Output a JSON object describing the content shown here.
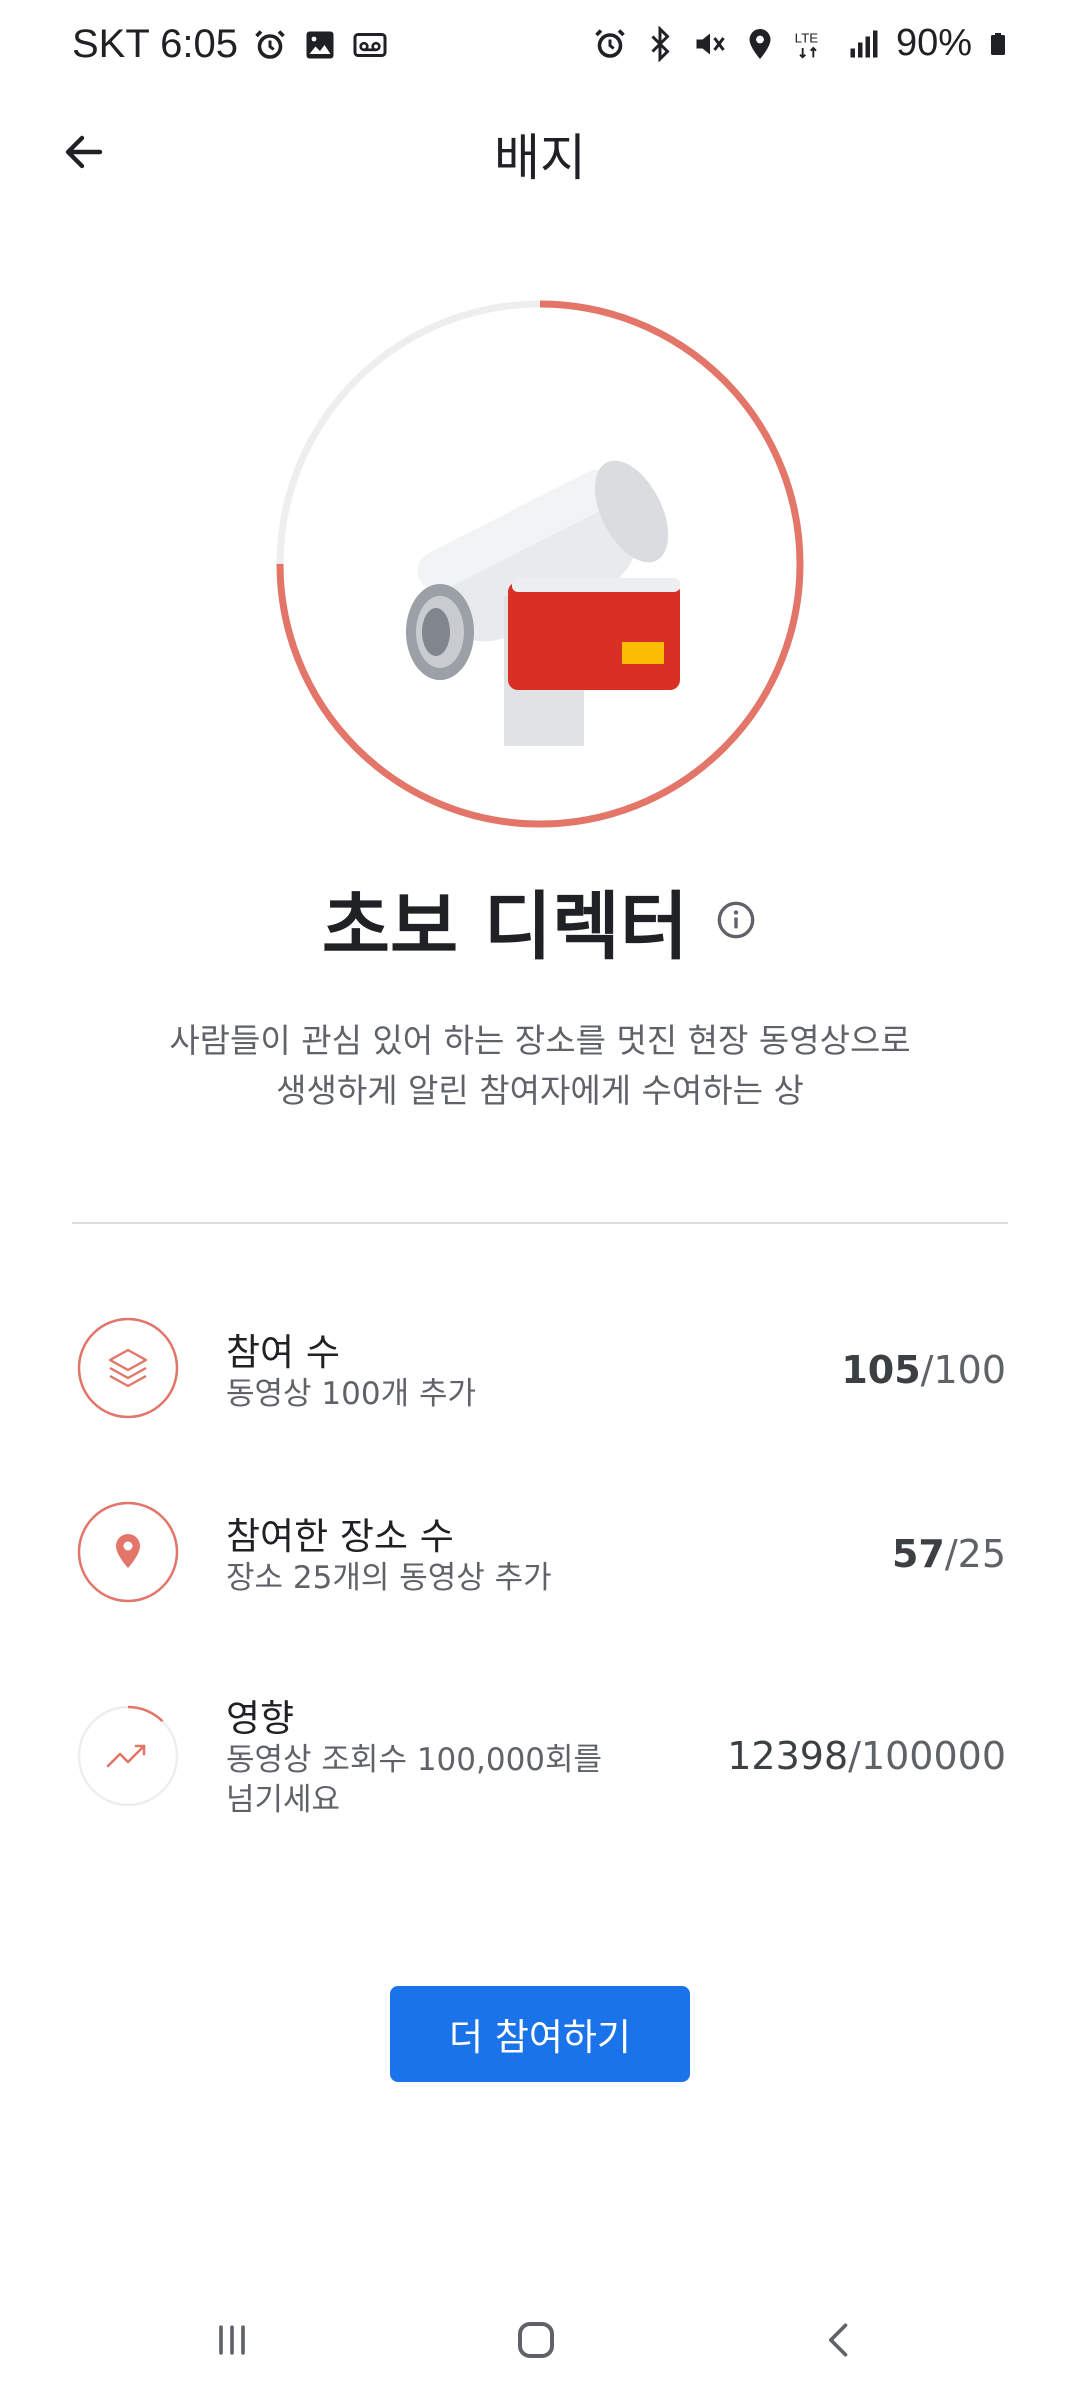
{
  "status_bar": {
    "carrier_time": "SKT 6:05",
    "network": "LTE",
    "battery": "90%",
    "left_icons": [
      "alarm-icon",
      "image-icon",
      "voicemail-icon"
    ],
    "right_icons": [
      "alarm-icon",
      "bluetooth-icon",
      "mute-icon",
      "location-icon",
      "lte-icon",
      "signal-icon",
      "battery-icon"
    ]
  },
  "app_bar": {
    "title": "배지"
  },
  "badge": {
    "name": "초보 디렉터",
    "description_line1": "사람들이 관심 있어 하는 장소를 멋진 현장 동영상으로",
    "description_line2": "생생하게 알린 참여자에게 수여하는 상",
    "progress_fraction": 0.75,
    "accent_color": "#e37569"
  },
  "criteria": [
    {
      "icon": "layers-icon",
      "title": "참여 수",
      "subtitle": "동영상 100개 추가",
      "current": "105",
      "separator": "/",
      "target": "100",
      "progress_fraction": 1.0
    },
    {
      "icon": "location-pin-icon",
      "title": "참여한 장소 수",
      "subtitle": "장소 25개의 동영상 추가",
      "current": "57",
      "separator": "/",
      "target": "25",
      "progress_fraction": 1.0
    },
    {
      "icon": "trending-up-icon",
      "title": "영향",
      "subtitle_line1": "동영상 조회수 100,000회를",
      "subtitle_line2": "넘기세요",
      "current": "12398",
      "separator": "/",
      "target": "100000",
      "progress_fraction": 0.124
    }
  ],
  "cta": {
    "label": "더 참여하기",
    "color": "#1a73e8"
  },
  "nav_bar": {
    "buttons": [
      "recent-apps-icon",
      "home-icon",
      "back-icon"
    ]
  }
}
